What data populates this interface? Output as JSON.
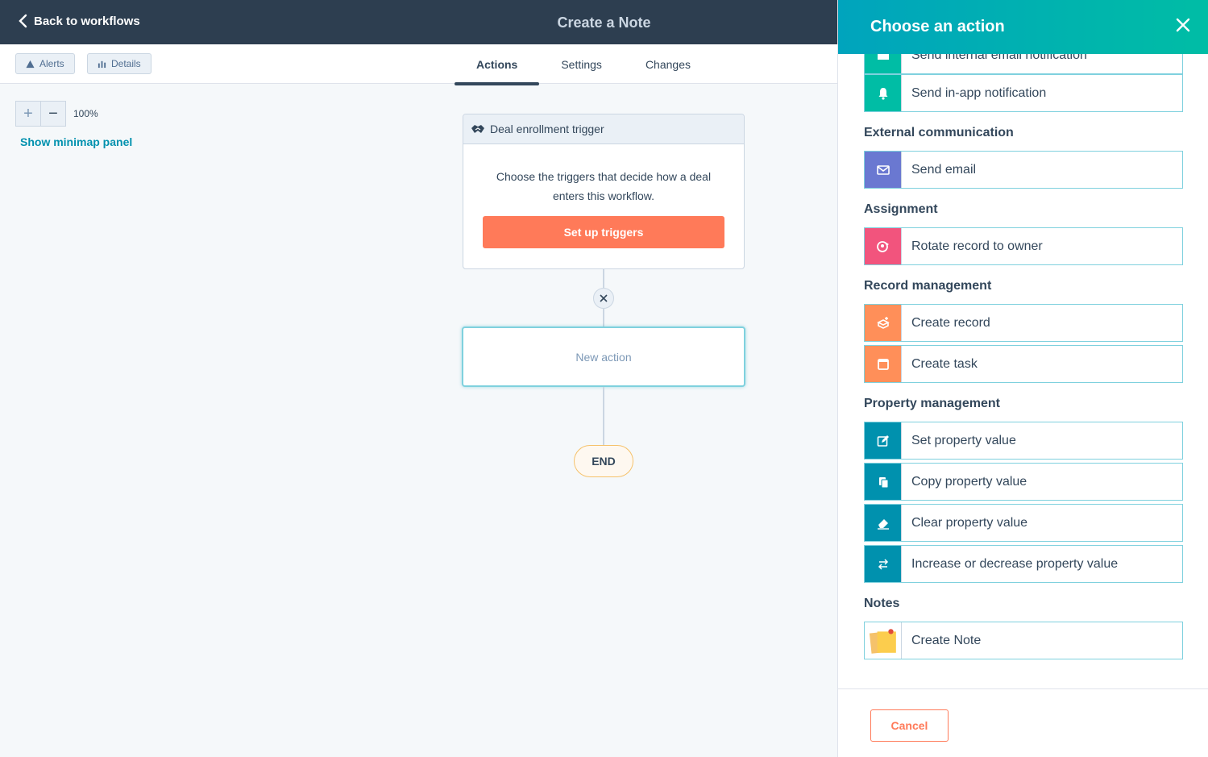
{
  "header": {
    "back_label": "Back to workflows",
    "title": "Create a Note"
  },
  "subbar": {
    "alerts_label": "Alerts",
    "details_label": "Details",
    "tabs": [
      {
        "label": "Actions",
        "active": true
      },
      {
        "label": "Settings",
        "active": false
      },
      {
        "label": "Changes",
        "active": false
      }
    ]
  },
  "canvas": {
    "zoom_plus": "+",
    "zoom_minus": "−",
    "zoom_level": "100%",
    "minimap_label": "Show minimap panel",
    "trigger": {
      "title": "Deal enrollment trigger",
      "description": "Choose the triggers that decide how a deal enters this workflow.",
      "button_label": "Set up triggers"
    },
    "new_action_label": "New action",
    "end_label": "END"
  },
  "panel": {
    "title": "Choose an action",
    "sections": {
      "external": "External communication",
      "assignment": "Assignment",
      "record": "Record management",
      "property": "Property management",
      "notes": "Notes"
    },
    "items": {
      "internal_email": "Send internal email notification",
      "in_app": "Send in-app notification",
      "send_email": "Send email",
      "rotate": "Rotate record to owner",
      "create_record": "Create record",
      "create_task": "Create task",
      "set_prop": "Set property value",
      "copy_prop": "Copy property value",
      "clear_prop": "Clear property value",
      "inc_prop": "Increase or decrease property value",
      "create_note": "Create Note"
    },
    "cancel_label": "Cancel"
  },
  "colors": {
    "topbar": "#2d3e50",
    "accent_teal": "#00a4bd",
    "accent_orange": "#ff7a59",
    "icon_green": "#00bda5",
    "icon_indigo": "#6a78d1",
    "icon_pink": "#f2547d",
    "icon_orange": "#ff8f59",
    "icon_teal": "#0091ae"
  }
}
